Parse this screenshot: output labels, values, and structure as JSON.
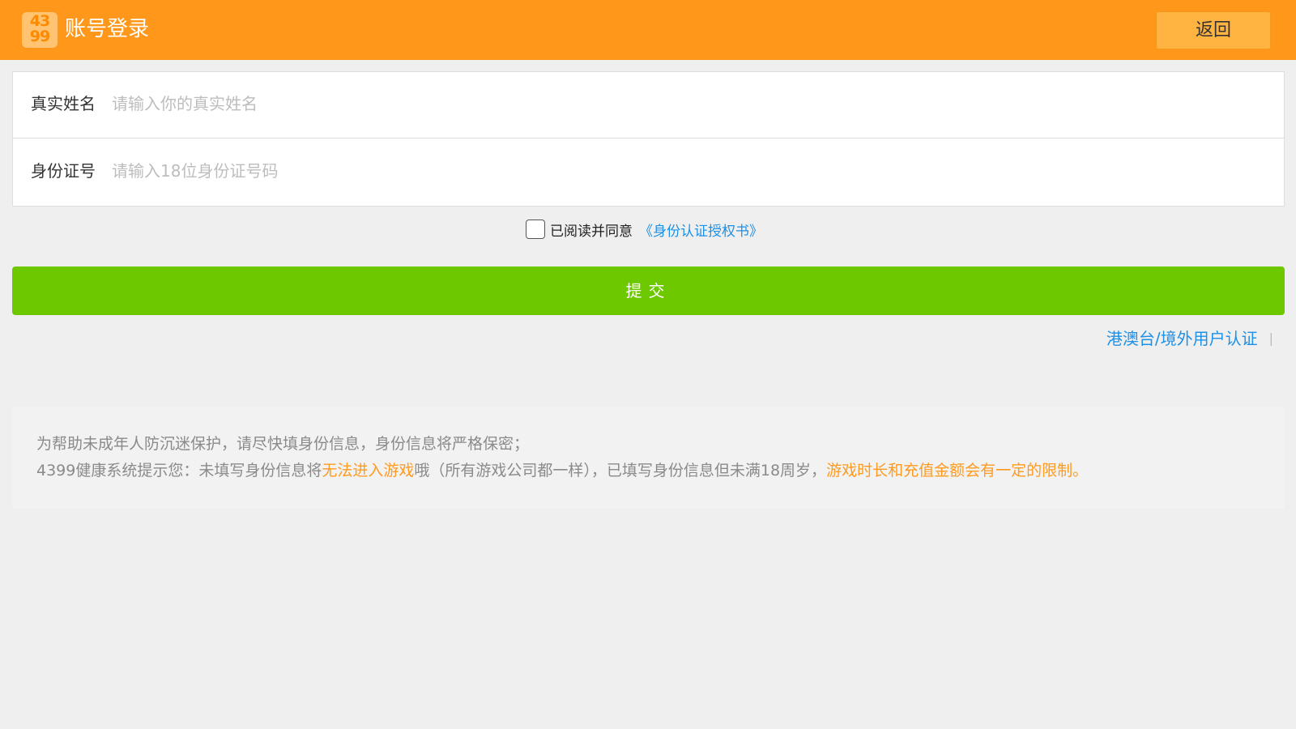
{
  "header": {
    "logo_text": "4399",
    "title": "账号登录",
    "back_label": "返回"
  },
  "form": {
    "name": {
      "label": "真实姓名",
      "placeholder": "请输入你的真实姓名"
    },
    "id_number": {
      "label": "身份证号",
      "placeholder": "请输入18位身份证号码"
    }
  },
  "agreement": {
    "checked": false,
    "text": "已阅读并同意",
    "link": "《身份认证授权书》"
  },
  "submit_label": "提交",
  "overseas": {
    "link": "港澳台/境外用户认证",
    "separator": "|"
  },
  "notice": {
    "line1": "为帮助未成年人防沉迷保护，请尽快填身份信息，身份信息将严格保密；",
    "line2_part1": "4399健康系统提示您：未填写身份信息将",
    "line2_hl1": "无法进入游戏",
    "line2_part2": "哦（所有游戏公司都一样），已填写身份信息但未满18周岁，",
    "line2_hl2": "游戏时长和充值金额会有一定的限制。"
  },
  "colors": {
    "header_bg": "#ff971a",
    "submit_bg": "#6ec800",
    "link": "#1e90e6",
    "highlight": "#ff9a1f"
  }
}
